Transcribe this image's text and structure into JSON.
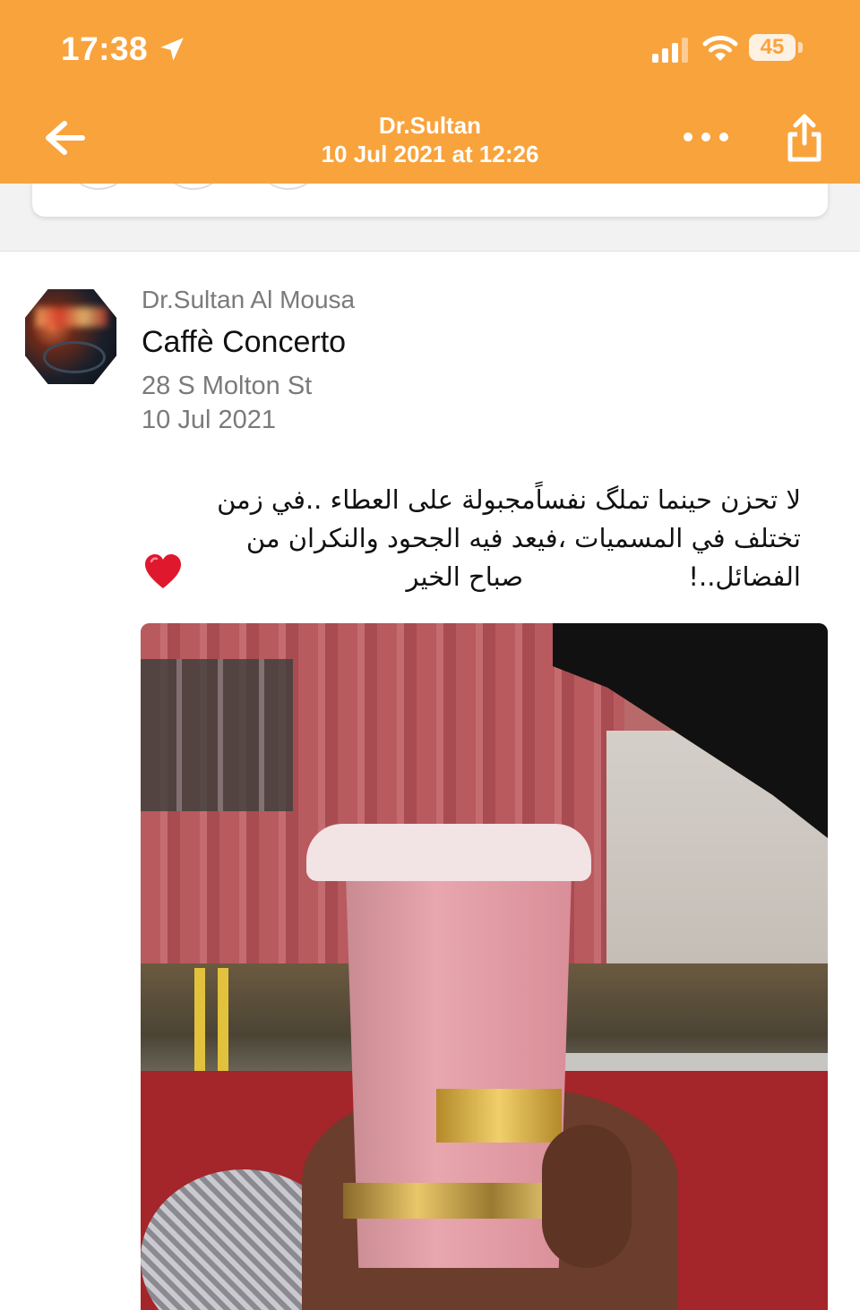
{
  "status_bar": {
    "time": "17:38",
    "battery": "45",
    "icons": [
      "location-arrow-icon",
      "signal-icon",
      "wifi-icon",
      "battery-icon"
    ]
  },
  "nav": {
    "title": "Dr.Sultan",
    "subtitle": "10 Jul 2021 at 12:26",
    "icons": [
      "back-arrow-icon",
      "more-icon",
      "share-icon"
    ]
  },
  "post": {
    "author": "Dr.Sultan Al Mousa",
    "venue": "Caffè Concerto",
    "address": "28 S Molton St",
    "date": "10 Jul 2021",
    "message": "لا تحزن حينما تملگ نفساًمجبولة على العطاء ..في زمن تختلف في المسميات ،فيعد فيه الجحود والنكران من الفضائل..!                    صباح الخير",
    "emoji": "heart-icon"
  },
  "colors": {
    "header": "#f9a33c",
    "secondary_text": "#7a7a7a",
    "primary_text": "#111111"
  }
}
